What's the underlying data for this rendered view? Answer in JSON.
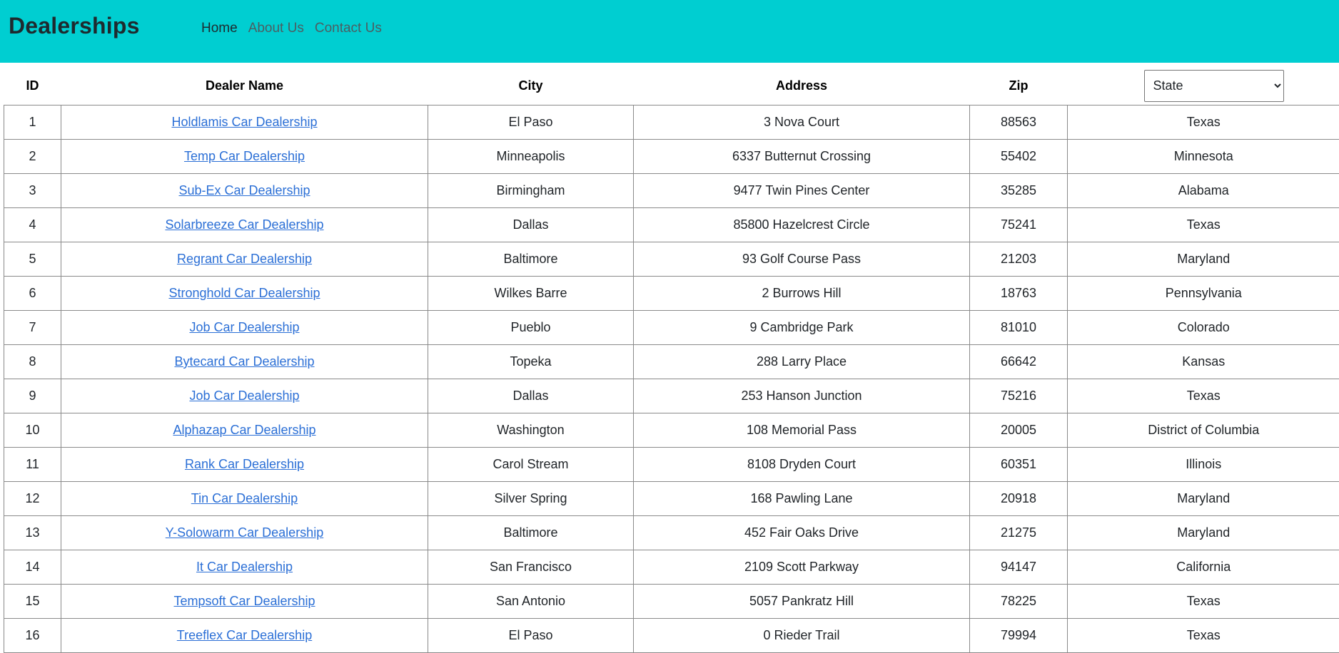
{
  "navbar": {
    "brand": "Dealerships",
    "links": [
      "Home",
      "About Us",
      "Contact Us"
    ],
    "bg_color": "#00ced1"
  },
  "table": {
    "headers": {
      "id": "ID",
      "name": "Dealer Name",
      "city": "City",
      "address": "Address",
      "zip": "Zip"
    },
    "state_filter": {
      "selected": "State"
    },
    "link_color": "#2b6fd6",
    "rows": [
      {
        "id": "1",
        "name": "Holdlamis Car Dealership",
        "city": "El Paso",
        "address": "3 Nova Court",
        "zip": "88563",
        "state": "Texas"
      },
      {
        "id": "2",
        "name": "Temp Car Dealership",
        "city": "Minneapolis",
        "address": "6337 Butternut Crossing",
        "zip": "55402",
        "state": "Minnesota"
      },
      {
        "id": "3",
        "name": "Sub-Ex Car Dealership",
        "city": "Birmingham",
        "address": "9477 Twin Pines Center",
        "zip": "35285",
        "state": "Alabama"
      },
      {
        "id": "4",
        "name": "Solarbreeze Car Dealership",
        "city": "Dallas",
        "address": "85800 Hazelcrest Circle",
        "zip": "75241",
        "state": "Texas"
      },
      {
        "id": "5",
        "name": "Regrant Car Dealership",
        "city": "Baltimore",
        "address": "93 Golf Course Pass",
        "zip": "21203",
        "state": "Maryland"
      },
      {
        "id": "6",
        "name": "Stronghold Car Dealership",
        "city": "Wilkes Barre",
        "address": "2 Burrows Hill",
        "zip": "18763",
        "state": "Pennsylvania"
      },
      {
        "id": "7",
        "name": "Job Car Dealership",
        "city": "Pueblo",
        "address": "9 Cambridge Park",
        "zip": "81010",
        "state": "Colorado"
      },
      {
        "id": "8",
        "name": "Bytecard Car Dealership",
        "city": "Topeka",
        "address": "288 Larry Place",
        "zip": "66642",
        "state": "Kansas"
      },
      {
        "id": "9",
        "name": "Job Car Dealership",
        "city": "Dallas",
        "address": "253 Hanson Junction",
        "zip": "75216",
        "state": "Texas"
      },
      {
        "id": "10",
        "name": "Alphazap Car Dealership",
        "city": "Washington",
        "address": "108 Memorial Pass",
        "zip": "20005",
        "state": "District of Columbia"
      },
      {
        "id": "11",
        "name": "Rank Car Dealership",
        "city": "Carol Stream",
        "address": "8108 Dryden Court",
        "zip": "60351",
        "state": "Illinois"
      },
      {
        "id": "12",
        "name": "Tin Car Dealership",
        "city": "Silver Spring",
        "address": "168 Pawling Lane",
        "zip": "20918",
        "state": "Maryland"
      },
      {
        "id": "13",
        "name": "Y-Solowarm Car Dealership",
        "city": "Baltimore",
        "address": "452 Fair Oaks Drive",
        "zip": "21275",
        "state": "Maryland"
      },
      {
        "id": "14",
        "name": "It Car Dealership",
        "city": "San Francisco",
        "address": "2109 Scott Parkway",
        "zip": "94147",
        "state": "California"
      },
      {
        "id": "15",
        "name": "Tempsoft Car Dealership",
        "city": "San Antonio",
        "address": "5057 Pankratz Hill",
        "zip": "78225",
        "state": "Texas"
      },
      {
        "id": "16",
        "name": "Treeflex Car Dealership",
        "city": "El Paso",
        "address": "0 Rieder Trail",
        "zip": "79994",
        "state": "Texas"
      }
    ]
  }
}
